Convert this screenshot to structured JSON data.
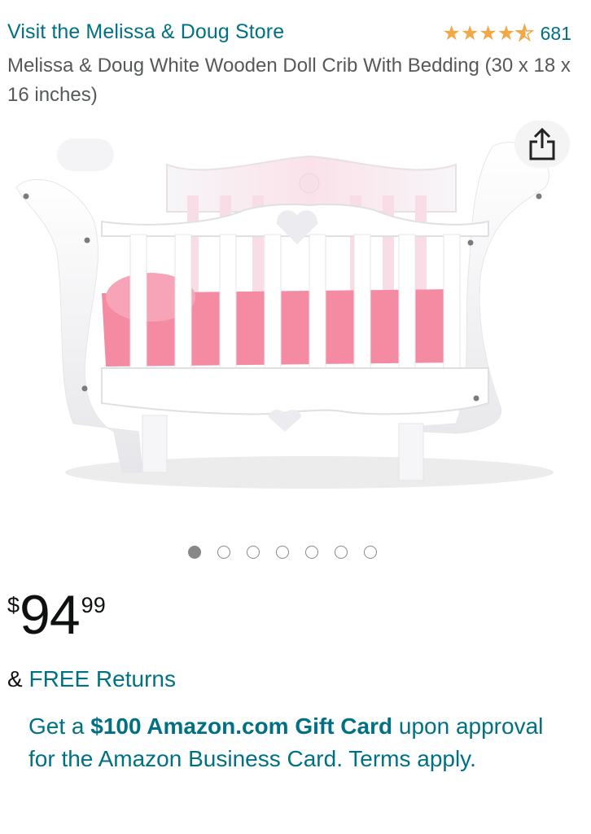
{
  "header": {
    "store_link": "Visit the Melissa & Doug Store",
    "rating_count": "681",
    "stars": 4.5,
    "star_color": "#f3a847"
  },
  "product": {
    "title": "Melissa & Doug White Wooden Doll Crib With Bedding (30 x 18 x 16 inches)"
  },
  "gallery": {
    "total_images": 7,
    "active_index": 0
  },
  "price": {
    "symbol": "$",
    "whole": "94",
    "fraction": "99"
  },
  "returns": {
    "prefix": "& ",
    "label": "FREE Returns"
  },
  "promo": {
    "pre": "Get a ",
    "bold": "$100 Amazon.com Gift Card",
    "post": " upon approval for the Amazon Business Card. Terms apply."
  },
  "colors": {
    "link": "#007185",
    "text": "#0f1111",
    "muted": "#565959"
  },
  "icons": {
    "share": "share-icon"
  }
}
